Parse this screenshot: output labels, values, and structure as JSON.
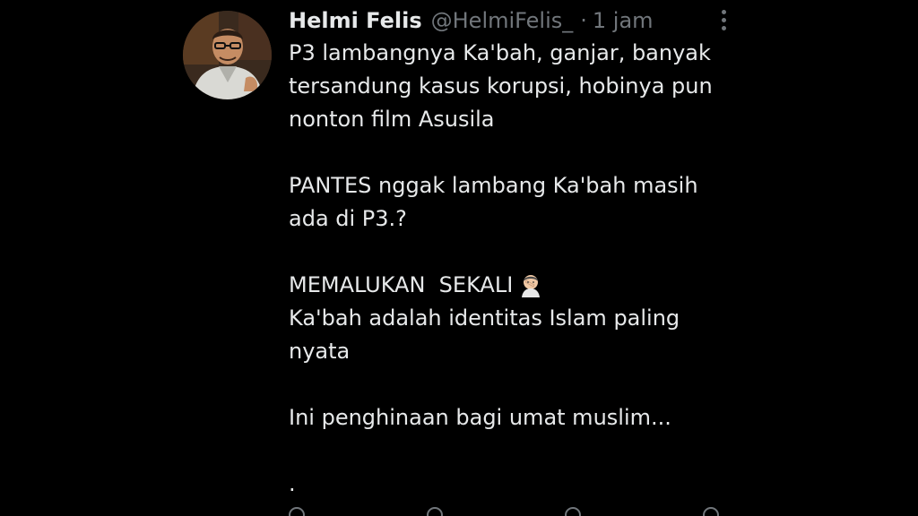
{
  "tweet": {
    "display_name": "Helmi Felis",
    "handle": "@HelmiFelis_",
    "separator": "·",
    "time": "1 jam",
    "lines": [
      "P3 lambangnya Ka'bah, ganjar, banyak",
      "tersandung kasus korupsi, hobinya pun",
      "nonton film Asusila",
      "",
      "PANTES nggak lambang Ka'bah masih",
      "ada di P3.?",
      "",
      "MEMALUKAN  SEKALI",
      "Ka'bah adalah identitas Islam paling",
      "nyata",
      "",
      "Ini penghinaan bagi umat muslim...",
      "",
      "."
    ],
    "emoji": "face-palm-emoji"
  },
  "icons": {
    "more": "more-vertical-icon",
    "avatar": "avatar-photo"
  },
  "colors": {
    "background": "#000000",
    "text": "#e7e9ea",
    "secondary": "#71767b"
  }
}
